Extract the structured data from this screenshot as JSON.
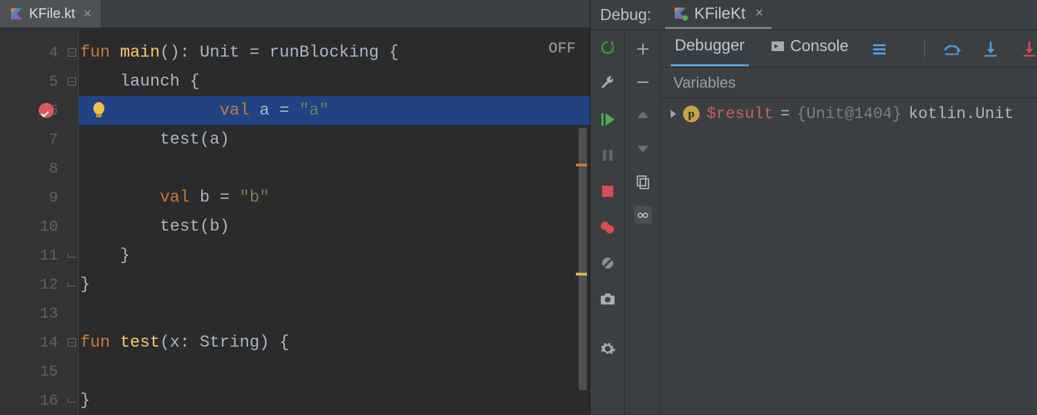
{
  "editor": {
    "tab": {
      "filename": "KFile.kt"
    },
    "off_label": "OFF",
    "gutter_start": 4,
    "gutter_end": 16,
    "breakpoint_line": 6,
    "highlighted_line": 6,
    "code_lines": [
      {
        "n": 4,
        "indent": 0,
        "tokens": [
          [
            "kw",
            "fun "
          ],
          [
            "fn",
            "main"
          ],
          [
            "op",
            "(): "
          ],
          [
            "ty",
            "Unit"
          ],
          [
            "op",
            " = "
          ],
          [
            "ty",
            "runBlocking"
          ],
          [
            "op",
            " {"
          ]
        ],
        "fold": "open"
      },
      {
        "n": 5,
        "indent": 1,
        "tokens": [
          [
            "ty",
            "launch"
          ],
          [
            "op",
            " {"
          ]
        ],
        "fold": "open"
      },
      {
        "n": 6,
        "indent": 2,
        "tokens": [
          [
            "kw",
            "val "
          ],
          [
            "ty",
            "a"
          ],
          [
            "op",
            " = "
          ],
          [
            "str",
            "\"a\""
          ]
        ],
        "bulb": true
      },
      {
        "n": 7,
        "indent": 2,
        "tokens": [
          [
            "ty",
            "test"
          ],
          [
            "op",
            "("
          ],
          [
            "ty",
            "a"
          ],
          [
            "op",
            ")"
          ]
        ]
      },
      {
        "n": 8,
        "indent": 0,
        "tokens": []
      },
      {
        "n": 9,
        "indent": 2,
        "tokens": [
          [
            "kw",
            "val "
          ],
          [
            "ty",
            "b"
          ],
          [
            "op",
            " = "
          ],
          [
            "str",
            "\"b\""
          ]
        ]
      },
      {
        "n": 10,
        "indent": 2,
        "tokens": [
          [
            "ty",
            "test"
          ],
          [
            "op",
            "("
          ],
          [
            "ty",
            "b"
          ],
          [
            "op",
            ")"
          ]
        ]
      },
      {
        "n": 11,
        "indent": 1,
        "tokens": [
          [
            "op",
            "}"
          ]
        ],
        "fold": "end"
      },
      {
        "n": 12,
        "indent": 0,
        "tokens": [
          [
            "op",
            "}"
          ]
        ],
        "fold": "end"
      },
      {
        "n": 13,
        "indent": 0,
        "tokens": []
      },
      {
        "n": 14,
        "indent": 0,
        "tokens": [
          [
            "kw",
            "fun "
          ],
          [
            "fn",
            "test"
          ],
          [
            "op",
            "("
          ],
          [
            "ty",
            "x"
          ],
          [
            "op",
            ": "
          ],
          [
            "ty",
            "String"
          ],
          [
            "op",
            ") {"
          ]
        ],
        "fold": "open"
      },
      {
        "n": 15,
        "indent": 0,
        "tokens": []
      },
      {
        "n": 16,
        "indent": 0,
        "tokens": [
          [
            "op",
            "}"
          ]
        ],
        "fold": "end"
      }
    ]
  },
  "debug": {
    "title": "Debug:",
    "run_config": "KFileKt",
    "tabs": {
      "debugger": "Debugger",
      "console": "Console"
    },
    "variables_header": "Variables",
    "result": {
      "badge": "p",
      "name": "$result",
      "eq": " = ",
      "value_brace": "{Unit@1404}",
      "value_tail": " kotlin.Unit"
    }
  }
}
